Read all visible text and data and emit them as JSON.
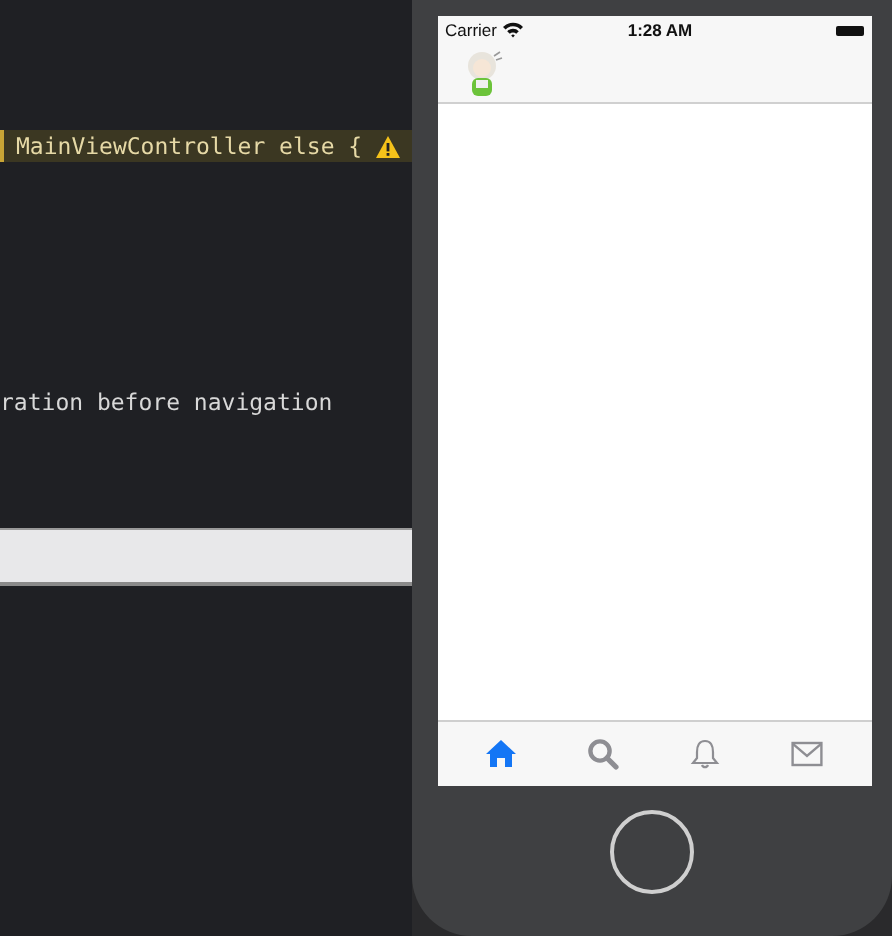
{
  "editor": {
    "lines": [
      {
        "text": "MainViewController else {",
        "highlighted": true,
        "warning": true
      },
      {
        "text": "ration before navigation",
        "highlighted": false,
        "warning": false
      }
    ]
  },
  "simulator": {
    "status_bar": {
      "carrier": "Carrier",
      "time": "1:28 AM"
    },
    "tab_bar": [
      {
        "kind": "home",
        "selected": true
      },
      {
        "kind": "search",
        "selected": false
      },
      {
        "kind": "bell",
        "selected": false
      },
      {
        "kind": "mail",
        "selected": false
      }
    ]
  }
}
